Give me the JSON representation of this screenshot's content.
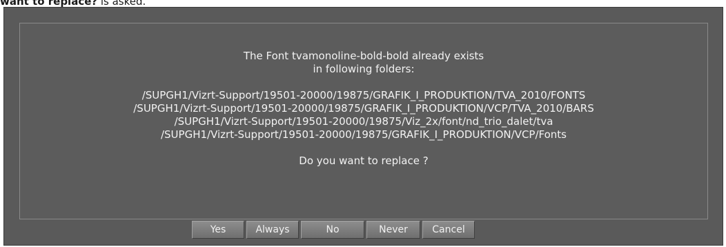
{
  "caption": {
    "bold": "want to replace?",
    "rest": " is asked."
  },
  "dialog": {
    "message": {
      "line1": "The Font tvamonoline-bold-bold already exists",
      "line2": "in following folders:",
      "folders": [
        "/SUPGH1/Vizrt-Support/19501-20000/19875/GRAFIK_I_PRODUKTION/TVA_2010/FONTS",
        "/SUPGH1/Vizrt-Support/19501-20000/19875/GRAFIK_I_PRODUKTION/VCP/TVA_2010/BARS",
        "/SUPGH1/Vizrt-Support/19501-20000/19875/Viz_2x/font/nd_trio_dalet/tva",
        "/SUPGH1/Vizrt-Support/19501-20000/19875/GRAFIK_I_PRODUKTION/VCP/Fonts"
      ],
      "question": "Do you want to replace ?"
    },
    "buttons": {
      "yes": "Yes",
      "always": "Always",
      "no": "No",
      "never": "Never",
      "cancel": "Cancel"
    }
  }
}
